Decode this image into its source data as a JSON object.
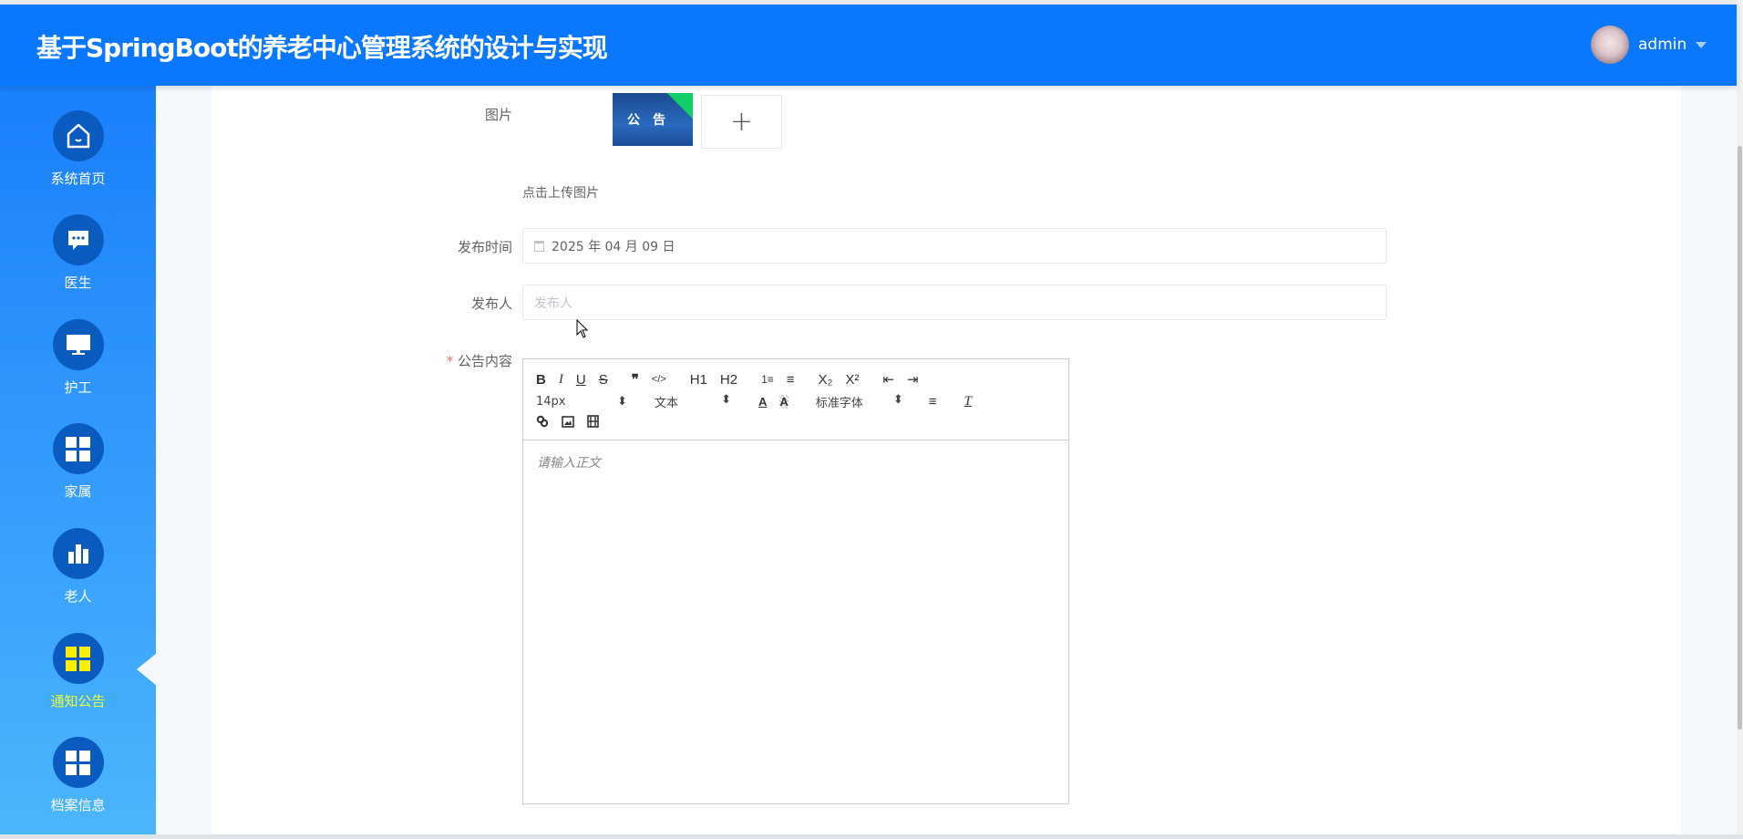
{
  "header": {
    "title": "基于SpringBoot的养老中心管理系统的设计与实现",
    "user": "admin"
  },
  "sidebar": {
    "items": [
      {
        "label": "系统首页",
        "icon": "home-icon"
      },
      {
        "label": "医生",
        "icon": "message-icon"
      },
      {
        "label": "护工",
        "icon": "monitor-icon"
      },
      {
        "label": "家属",
        "icon": "grid-icon"
      },
      {
        "label": "老人",
        "icon": "bar-chart-icon"
      },
      {
        "label": "通知公告",
        "icon": "grid-icon",
        "active": true
      },
      {
        "label": "档案信息",
        "icon": "grid-icon"
      }
    ]
  },
  "form": {
    "image_label": "图片",
    "image_thumb_text": "公告",
    "upload_plus": "+",
    "upload_hint": "点击上传图片",
    "date_label": "发布时间",
    "date_value": "2025 年 04 月 09 日",
    "publisher_label": "发布人",
    "publisher_placeholder": "发布人",
    "content_label": "公告内容",
    "required_mark": "*"
  },
  "editor": {
    "row1": [
      "B",
      "I",
      "U",
      "S",
      "❞",
      "</>",
      "H1",
      "H2",
      "1≡",
      "≡",
      "X₂",
      "X²",
      "⇤",
      "⇥"
    ],
    "size": "14px",
    "block": "文本",
    "font": "标准字体",
    "placeholder": "请输入正文"
  }
}
